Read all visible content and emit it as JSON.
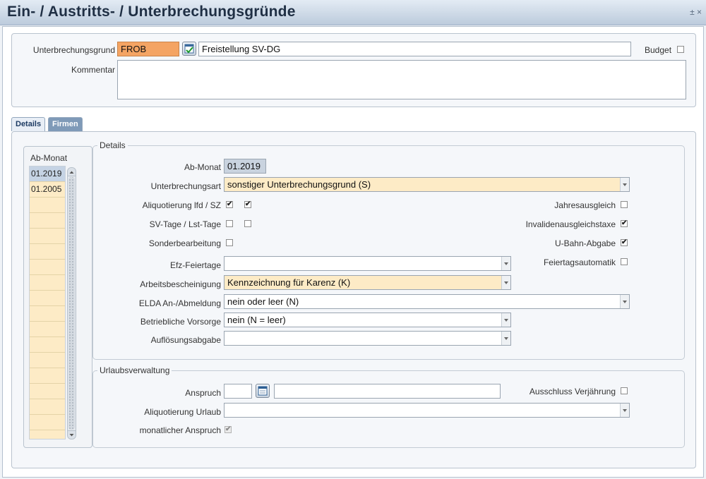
{
  "window": {
    "title": "Ein- / Austritts- / Unterbrechungsgründe",
    "controls": "± ×"
  },
  "header": {
    "grund_label": "Unterbrechungsgrund",
    "grund_code": "FROB",
    "grund_text": "Freistellung SV-DG",
    "budget_label": "Budget",
    "budget_checked": false,
    "kommentar_label": "Kommentar",
    "kommentar_value": ""
  },
  "tabs": [
    {
      "label": "Details",
      "active": true
    },
    {
      "label": "Firmen",
      "active": false
    }
  ],
  "monat_list": {
    "header": "Ab-Monat",
    "items": [
      "01.2019",
      "01.2005"
    ],
    "selected": 0
  },
  "details": {
    "title": "Details",
    "ab_monat_label": "Ab-Monat",
    "ab_monat_value": "01.2019",
    "unterbrechungsart_label": "Unterbrechungsart",
    "unterbrechungsart_value": "sonstiger Unterbrechungsgrund (S)",
    "aliquotierung_label": "Aliquotierung lfd / SZ",
    "aliquotierung_lfd": true,
    "aliquotierung_sz": true,
    "sv_tage_label": "SV-Tage / Lst-Tage",
    "sv_tage": false,
    "lst_tage": false,
    "sonderbearbeitung_label": "Sonderbearbeitung",
    "sonderbearbeitung": false,
    "jahresausgleich_label": "Jahresausgleich",
    "jahresausgleich": false,
    "invalidenausgleichstaxe_label": "Invalidenausgleichstaxe",
    "invalidenausgleichstaxe": true,
    "ubahn_label": "U-Bahn-Abgabe",
    "ubahn": true,
    "feiertagsautomatik_label": "Feiertagsautomatik",
    "feiertagsautomatik": false,
    "efz_label": "Efz-Feiertage",
    "efz_value": "",
    "arbeitsbescheinigung_label": "Arbeitsbescheinigung",
    "arbeitsbescheinigung_value": "Kennzeichnung für Karenz (K)",
    "elda_label": "ELDA An-/Abmeldung",
    "elda_value": "nein oder leer (N)",
    "vorsorge_label": "Betriebliche Vorsorge",
    "vorsorge_value": "nein (N = leer)",
    "aufloesung_label": "Auflösungsabgabe",
    "aufloesung_value": ""
  },
  "urlaub": {
    "title": "Urlaubsverwaltung",
    "anspruch_label": "Anspruch",
    "anspruch_value": "",
    "anspruch_text": "",
    "ausschluss_label": "Ausschluss Verjährung",
    "ausschluss": false,
    "aliquotierung_label": "Aliquotierung Urlaub",
    "aliquotierung_value": "",
    "monatlich_label": "monatlicher Anspruch",
    "monatlich": true
  },
  "colors": {
    "required_field": "#f4a463",
    "combo_yellow": "#fdebc6",
    "title_text": "#1f2f44"
  }
}
